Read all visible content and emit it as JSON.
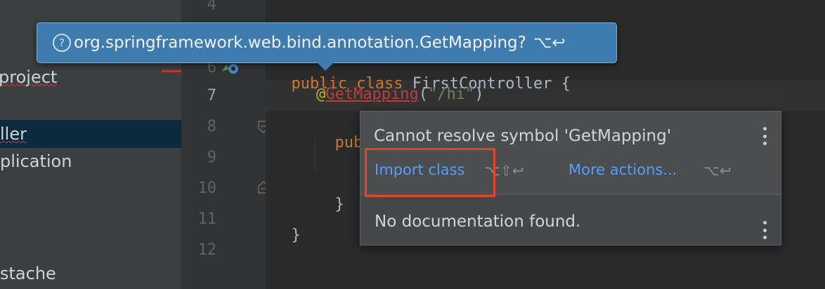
{
  "sidebar": {
    "items": [
      {
        "label": "project"
      },
      {
        "label": "ller"
      },
      {
        "label": "plication"
      },
      {
        "label": "stache"
      }
    ]
  },
  "gutter": {
    "line_numbers": [
      "4",
      "6",
      "7",
      "8",
      "9",
      "10",
      "11",
      "12"
    ]
  },
  "code": {
    "line6": {
      "kw1": "public",
      "kw2": "class",
      "name": "FirstController {"
    },
    "line7": {
      "at": "@",
      "annotation": "GetMapping",
      "open": "(",
      "str": "\"/hi\"",
      "close": ")"
    },
    "line8": {
      "kw": "publ"
    },
    "line10": {
      "text": "}"
    },
    "line11": {
      "text": "}"
    }
  },
  "hint": {
    "help_icon": "?",
    "text": "org.springframework.web.bind.annotation.GetMapping?",
    "shortcut": "⌥↩"
  },
  "popup": {
    "message": "Cannot resolve symbol 'GetMapping'",
    "import_label": "Import class",
    "import_shortcut": "⌥⇧↩",
    "more_label": "More actions...",
    "more_shortcut": "⌥↩",
    "doc_text": "No documentation found."
  },
  "icons": {
    "menu": "more-vertical-icon",
    "fold": "fold-marker-icon",
    "bean": "spring-bean-icon"
  },
  "colors": {
    "hint_bg": "#3e7bae",
    "link": "#589df6",
    "highlight": "#e2452b",
    "error": "#bc3f3c"
  }
}
